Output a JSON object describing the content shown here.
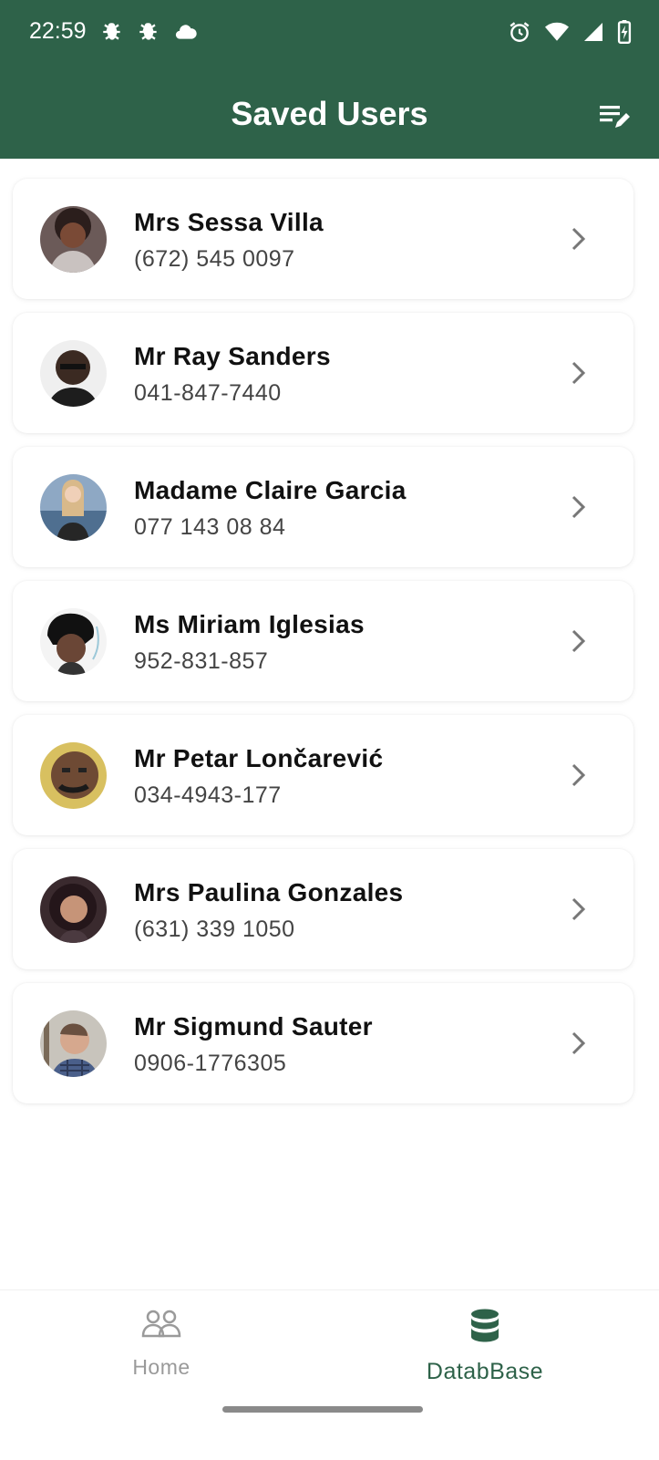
{
  "status_bar": {
    "time": "22:59"
  },
  "app_bar": {
    "title": "Saved Users"
  },
  "users": [
    {
      "name": "Mrs Sessa Villa",
      "phone": "(672) 545 0097"
    },
    {
      "name": "Mr Ray Sanders",
      "phone": "041-847-7440"
    },
    {
      "name": "Madame Claire Garcia",
      "phone": "077 143 08 84"
    },
    {
      "name": "Ms Miriam Iglesias",
      "phone": "952-831-857"
    },
    {
      "name": "Mr Petar Lončarević",
      "phone": "034-4943-177"
    },
    {
      "name": "Mrs Paulina Gonzales",
      "phone": "(631) 339 1050"
    },
    {
      "name": "Mr Sigmund Sauter",
      "phone": "0906-1776305"
    }
  ],
  "bottom_nav": {
    "home_label": "Home",
    "database_label": "DatabBase",
    "active": "database"
  },
  "colors": {
    "primary": "#2e6249",
    "inactive": "#9a9a9a"
  }
}
